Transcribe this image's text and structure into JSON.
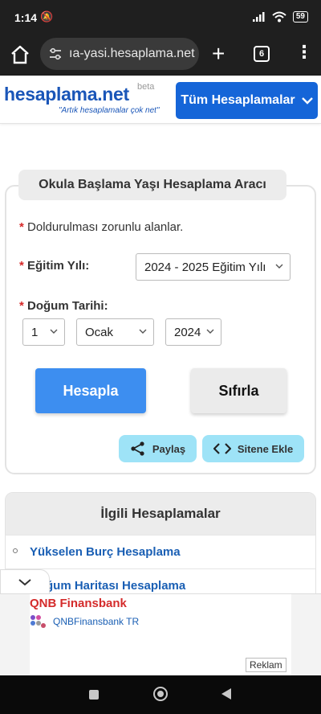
{
  "status": {
    "time": "1:14",
    "battery": "59"
  },
  "browser": {
    "url": "ıa-yasi.hesaplama.net",
    "tab_count": "6"
  },
  "site": {
    "logo": "hesaplama.net",
    "beta": "beta",
    "slogan": "\"Artık hesaplamalar çok net\"",
    "all_button": "Tüm Hesaplamalar"
  },
  "form": {
    "title": "Okula Başlama Yaşı Hesaplama Aracı",
    "required_star": "*",
    "required_note": "Doldurulması zorunlu alanlar.",
    "year_label": "Eğitim Yılı:",
    "year_value": "2024 - 2025 Eğitim Yılı",
    "birth_label": "Doğum Tarihi:",
    "day_value": "1",
    "month_value": "Ocak",
    "birth_year_value": "2024",
    "calc_button": "Hesapla",
    "reset_button": "Sıfırla",
    "share_button": "Paylaş",
    "embed_button": "Sitene Ekle"
  },
  "related": {
    "title": "İlgili Hesaplamalar",
    "items": [
      "Yükselen Burç Hesaplama",
      "Doğum Haritası Hesaplama"
    ]
  },
  "ad": {
    "title": "QNB Finansbank",
    "subtitle": "QNBFinansbank TR",
    "label": "Reklam"
  },
  "colors": {
    "brand": "#1565d8",
    "primary_button": "#3d8ef0",
    "pill": "#9ee3f7",
    "required": "#d62828",
    "ad_title": "#d42b2b"
  }
}
